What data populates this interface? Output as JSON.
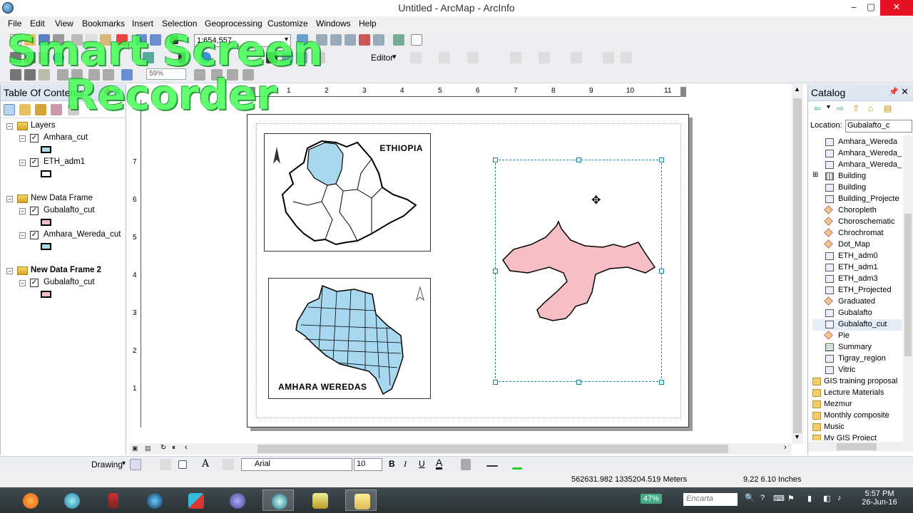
{
  "window": {
    "title": "Untitled - ArcMap - ArcInfo",
    "minimize": "–",
    "maximize": "▢",
    "close": "✕"
  },
  "menu": [
    "File",
    "Edit",
    "View",
    "Bookmarks",
    "Insert",
    "Selection",
    "Geoprocessing",
    "Customize",
    "Windows",
    "Help"
  ],
  "toolbar": {
    "scale": "1:654,557",
    "zoom": "59%",
    "editor": "Editor"
  },
  "watermark": {
    "line1": "Smart Screen",
    "line2": "Recorder"
  },
  "toc": {
    "title": "Table Of Contents",
    "frames": [
      {
        "name": "Layers",
        "layers": [
          {
            "name": "Amhara_cut",
            "fill": "#a8d8f0"
          },
          {
            "name": "ETH_adm1",
            "fill": "#ffffff"
          }
        ]
      },
      {
        "name": "New Data Frame",
        "layers": [
          {
            "name": "Gubalafto_cut",
            "fill": "#f5bfc4"
          },
          {
            "name": "Amhara_Wereda_cut",
            "fill": "#a8d8f0"
          }
        ]
      },
      {
        "name": "New Data Frame 2",
        "layers": [
          {
            "name": "Gubalafto_cut",
            "fill": "#f5bfc4"
          }
        ]
      }
    ]
  },
  "layout": {
    "ruler_labels": [
      "1",
      "2",
      "3",
      "4",
      "5",
      "6",
      "7",
      "8",
      "9",
      "10",
      "11"
    ],
    "ruler_v_labels": [
      "7",
      "6",
      "5",
      "4",
      "3",
      "2",
      "1"
    ],
    "map1_label": "ETHIOPIA",
    "map2_label": "AMHARA WEREDAS",
    "north": "N",
    "colors": {
      "blue": "#a8d8f0",
      "pink": "#f5bfc4",
      "selection": "#1b7fa0"
    }
  },
  "catalog": {
    "title": "Catalog",
    "location_label": "Location:",
    "location_value": "Gubalafto_c",
    "items": [
      {
        "name": "Amhara_Wereda",
        "icon": "feature-class-icon"
      },
      {
        "name": "Amhara_Wereda_",
        "icon": "feature-class-icon"
      },
      {
        "name": "Amhara_Wereda_",
        "icon": "feature-class-icon"
      },
      {
        "name": "Building",
        "icon": "raster-icon"
      },
      {
        "name": "Building",
        "icon": "feature-class-icon"
      },
      {
        "name": "Building_Projecte",
        "icon": "feature-class-icon"
      },
      {
        "name": "Choropleth",
        "icon": "layer-file-icon"
      },
      {
        "name": "Choroschematic",
        "icon": "layer-file-icon"
      },
      {
        "name": "Chrochromat",
        "icon": "layer-file-icon"
      },
      {
        "name": "Dot_Map",
        "icon": "layer-file-icon"
      },
      {
        "name": "ETH_adm0",
        "icon": "feature-class-icon"
      },
      {
        "name": "ETH_adm1",
        "icon": "feature-class-icon"
      },
      {
        "name": "ETH_adm3",
        "icon": "feature-class-icon"
      },
      {
        "name": "ETH_Projected",
        "icon": "feature-class-icon"
      },
      {
        "name": "Graduated",
        "icon": "layer-file-icon"
      },
      {
        "name": "Gubalafto",
        "icon": "feature-class-icon"
      },
      {
        "name": "Gubalafto_cut",
        "icon": "feature-class-icon"
      },
      {
        "name": "Pie",
        "icon": "layer-file-icon"
      },
      {
        "name": "Summary",
        "icon": "table-icon"
      },
      {
        "name": "Tigray_region",
        "icon": "feature-class-icon"
      },
      {
        "name": "Vitric",
        "icon": "feature-class-icon"
      }
    ],
    "folders": [
      "GIS training proposal",
      "Lecture Materials",
      "Mezmur",
      "Monthly composite",
      "Music",
      "My GIS Project"
    ]
  },
  "drawing": {
    "label": "Drawing",
    "font": "Arial",
    "size": "10",
    "bold": "B",
    "italic": "I",
    "underline": "U"
  },
  "status": {
    "coords": "562631.982  1335204.519 Meters",
    "page": "9.22  6.10 Inches"
  },
  "taskbar": {
    "battery": "47%",
    "search": "Encarta",
    "time": "5:57 PM",
    "date": "26-Jun-16"
  }
}
